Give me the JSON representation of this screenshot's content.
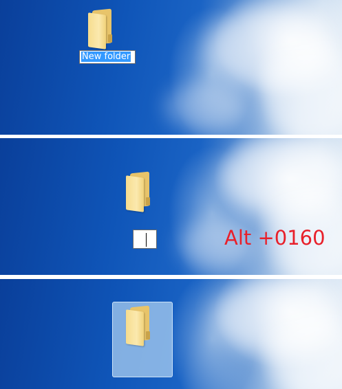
{
  "step1": {
    "folder_label": "New folder"
  },
  "step2": {
    "folder_label": "",
    "instruction": "Alt +0160"
  },
  "step3": {
    "folder_label": ""
  },
  "icons": {
    "folder": "folder-icon"
  },
  "colors": {
    "selection": "#3399ff",
    "instruction": "#e8202a",
    "desktop": "#0f55b8"
  }
}
